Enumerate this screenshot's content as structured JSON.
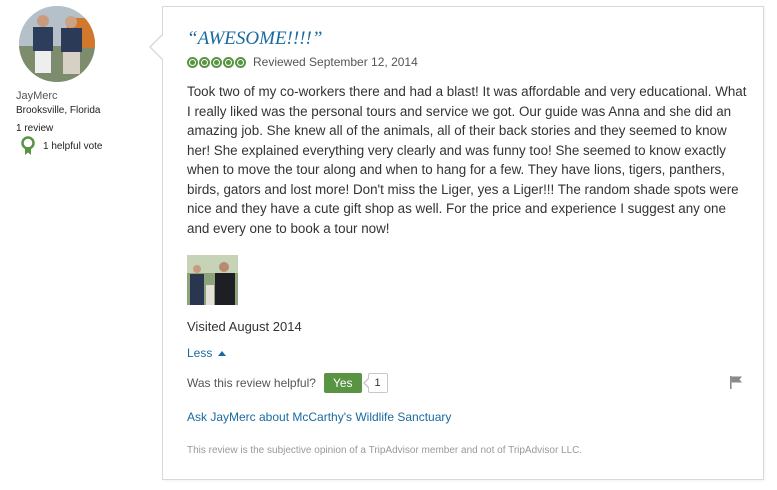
{
  "reviewer": {
    "name": "JayMerc",
    "location": "Brooksville, Florida",
    "review_count": "1 review",
    "helpful_votes": "1 helpful vote",
    "avatar_icon": "user-photo"
  },
  "review": {
    "title": "“AWESOME!!!!”",
    "rating_bubbles": 5,
    "rating_max": 5,
    "reviewed_date": "Reviewed September 12, 2014",
    "text": "Took two of my co-workers there and had a blast! It was affordable and very educational. What I really liked was the personal tours and service we got. Our guide was Anna and she did an amazing job. She knew all of the animals, all of their back stories and they seemed to know her! She explained everything very clearly and was funny too! She seemed to know exactly when to move the tour along and when to hang for a few. They have lions, tigers, panthers, birds, gators and lost more! Don't miss the Liger, yes a Liger!!! The random shade spots were nice and they have a cute gift shop as well. For the price and experience I suggest any one and every one to book a tour now!",
    "visited": "Visited August 2014",
    "less_label": "Less",
    "helpful_question": "Was this review helpful?",
    "yes_label": "Yes",
    "yes_count": "1",
    "ask_link": "Ask JayMerc about McCarthy's Wildlife Sanctuary",
    "disclaimer": "This review is the subjective opinion of a TripAdvisor member and not of TripAdvisor LLC."
  },
  "colors": {
    "link_blue": "#1a6aa0",
    "rating_green": "#589442",
    "badge_green": "#589442"
  }
}
